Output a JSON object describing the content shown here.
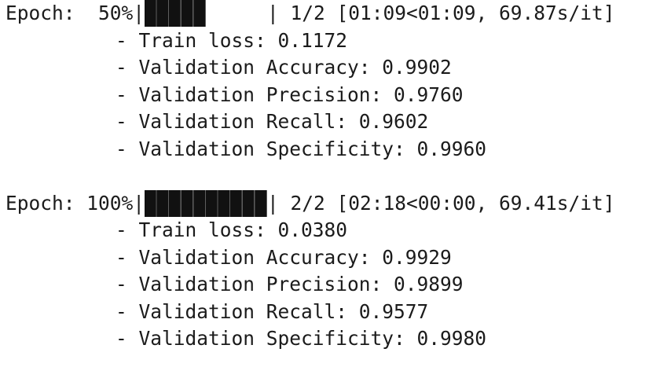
{
  "epochs": [
    {
      "label": "Epoch:  50%|",
      "progress": 0.5,
      "stats": "| 1/2 [01:09<01:09, 69.87s/it]",
      "train_loss": "- Train loss: 0.1172",
      "val_accuracy": "- Validation Accuracy: 0.9902",
      "val_precision": "- Validation Precision: 0.9760",
      "val_recall": "- Validation Recall: 0.9602",
      "val_specificity": "- Validation Specificity: 0.9960"
    },
    {
      "label": "Epoch: 100%|",
      "progress": 1.0,
      "stats": "| 2/2 [02:18<00:00, 69.41s/it]",
      "train_loss": "- Train loss: 0.0380",
      "val_accuracy": "- Validation Accuracy: 0.9929",
      "val_precision": "- Validation Precision: 0.9899",
      "val_recall": "- Validation Recall: 0.9577",
      "val_specificity": "- Validation Specificity: 0.9980"
    }
  ],
  "colors": {
    "text": "#1b1b1b",
    "bar_fill": "#111111",
    "background": "#ffffff"
  }
}
